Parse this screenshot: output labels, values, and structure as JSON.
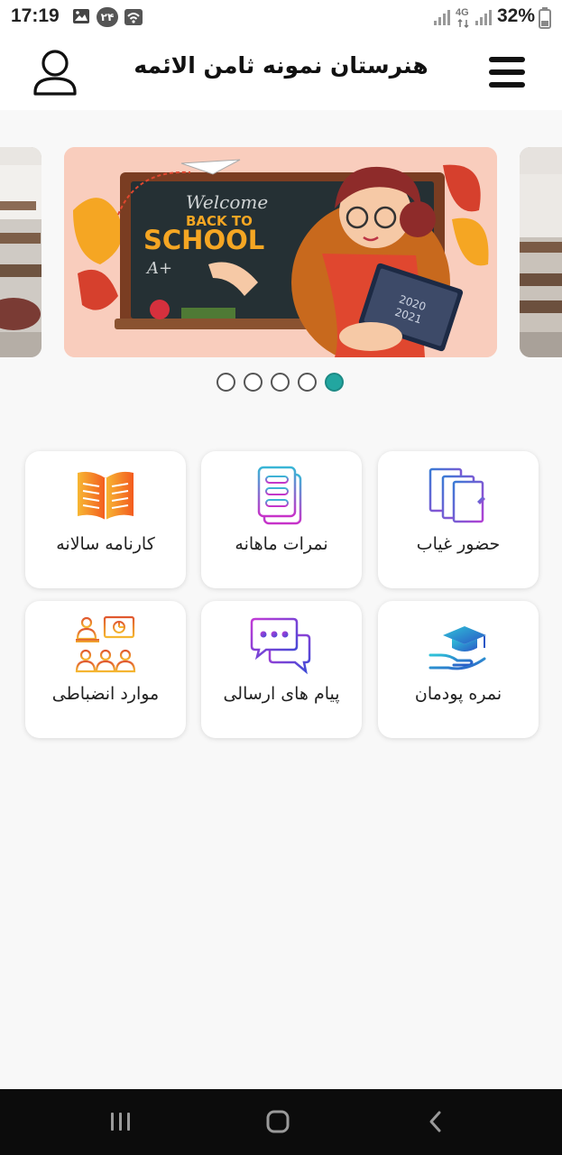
{
  "status_bar": {
    "time": "17:19",
    "notification_badge": "۲۴",
    "network": "4G",
    "battery": "32%",
    "icons": [
      "image-icon",
      "badge-icon",
      "wifi-icon",
      "signal-icon",
      "signal-4g-icon",
      "signal-icon",
      "battery-icon"
    ]
  },
  "header": {
    "title": "هنرستان نمونه ثامن الائمه",
    "menu_icon": "menu-icon",
    "profile_icon": "user-icon"
  },
  "carousel": {
    "slides": [
      {
        "name": "classroom-photo-left"
      },
      {
        "name": "back-to-school-banner",
        "welcome": "Welcome",
        "back_to": "BACK TO",
        "school": "SCHOOL",
        "years": [
          "2020",
          "2021"
        ],
        "grade": "A+"
      },
      {
        "name": "classroom-photo-right"
      }
    ],
    "dot_count": 5,
    "active_dot": 5,
    "active_color": "#22a6a0"
  },
  "menu": {
    "items": [
      {
        "label": "حضور غیاب",
        "icon": "attendance-documents-icon"
      },
      {
        "label": "نمرات ماهانه",
        "icon": "monthly-grades-list-icon"
      },
      {
        "label": "کارنامه سالانه",
        "icon": "annual-report-book-icon"
      },
      {
        "label": "نمره پودمان",
        "icon": "module-grade-graduation-icon"
      },
      {
        "label": "پیام های ارسالی",
        "icon": "sent-messages-chat-icon"
      },
      {
        "label": "موارد انضباطی",
        "icon": "discipline-class-icon"
      }
    ]
  },
  "system_nav": {
    "buttons": [
      "recents-icon",
      "home-icon",
      "back-icon"
    ]
  }
}
